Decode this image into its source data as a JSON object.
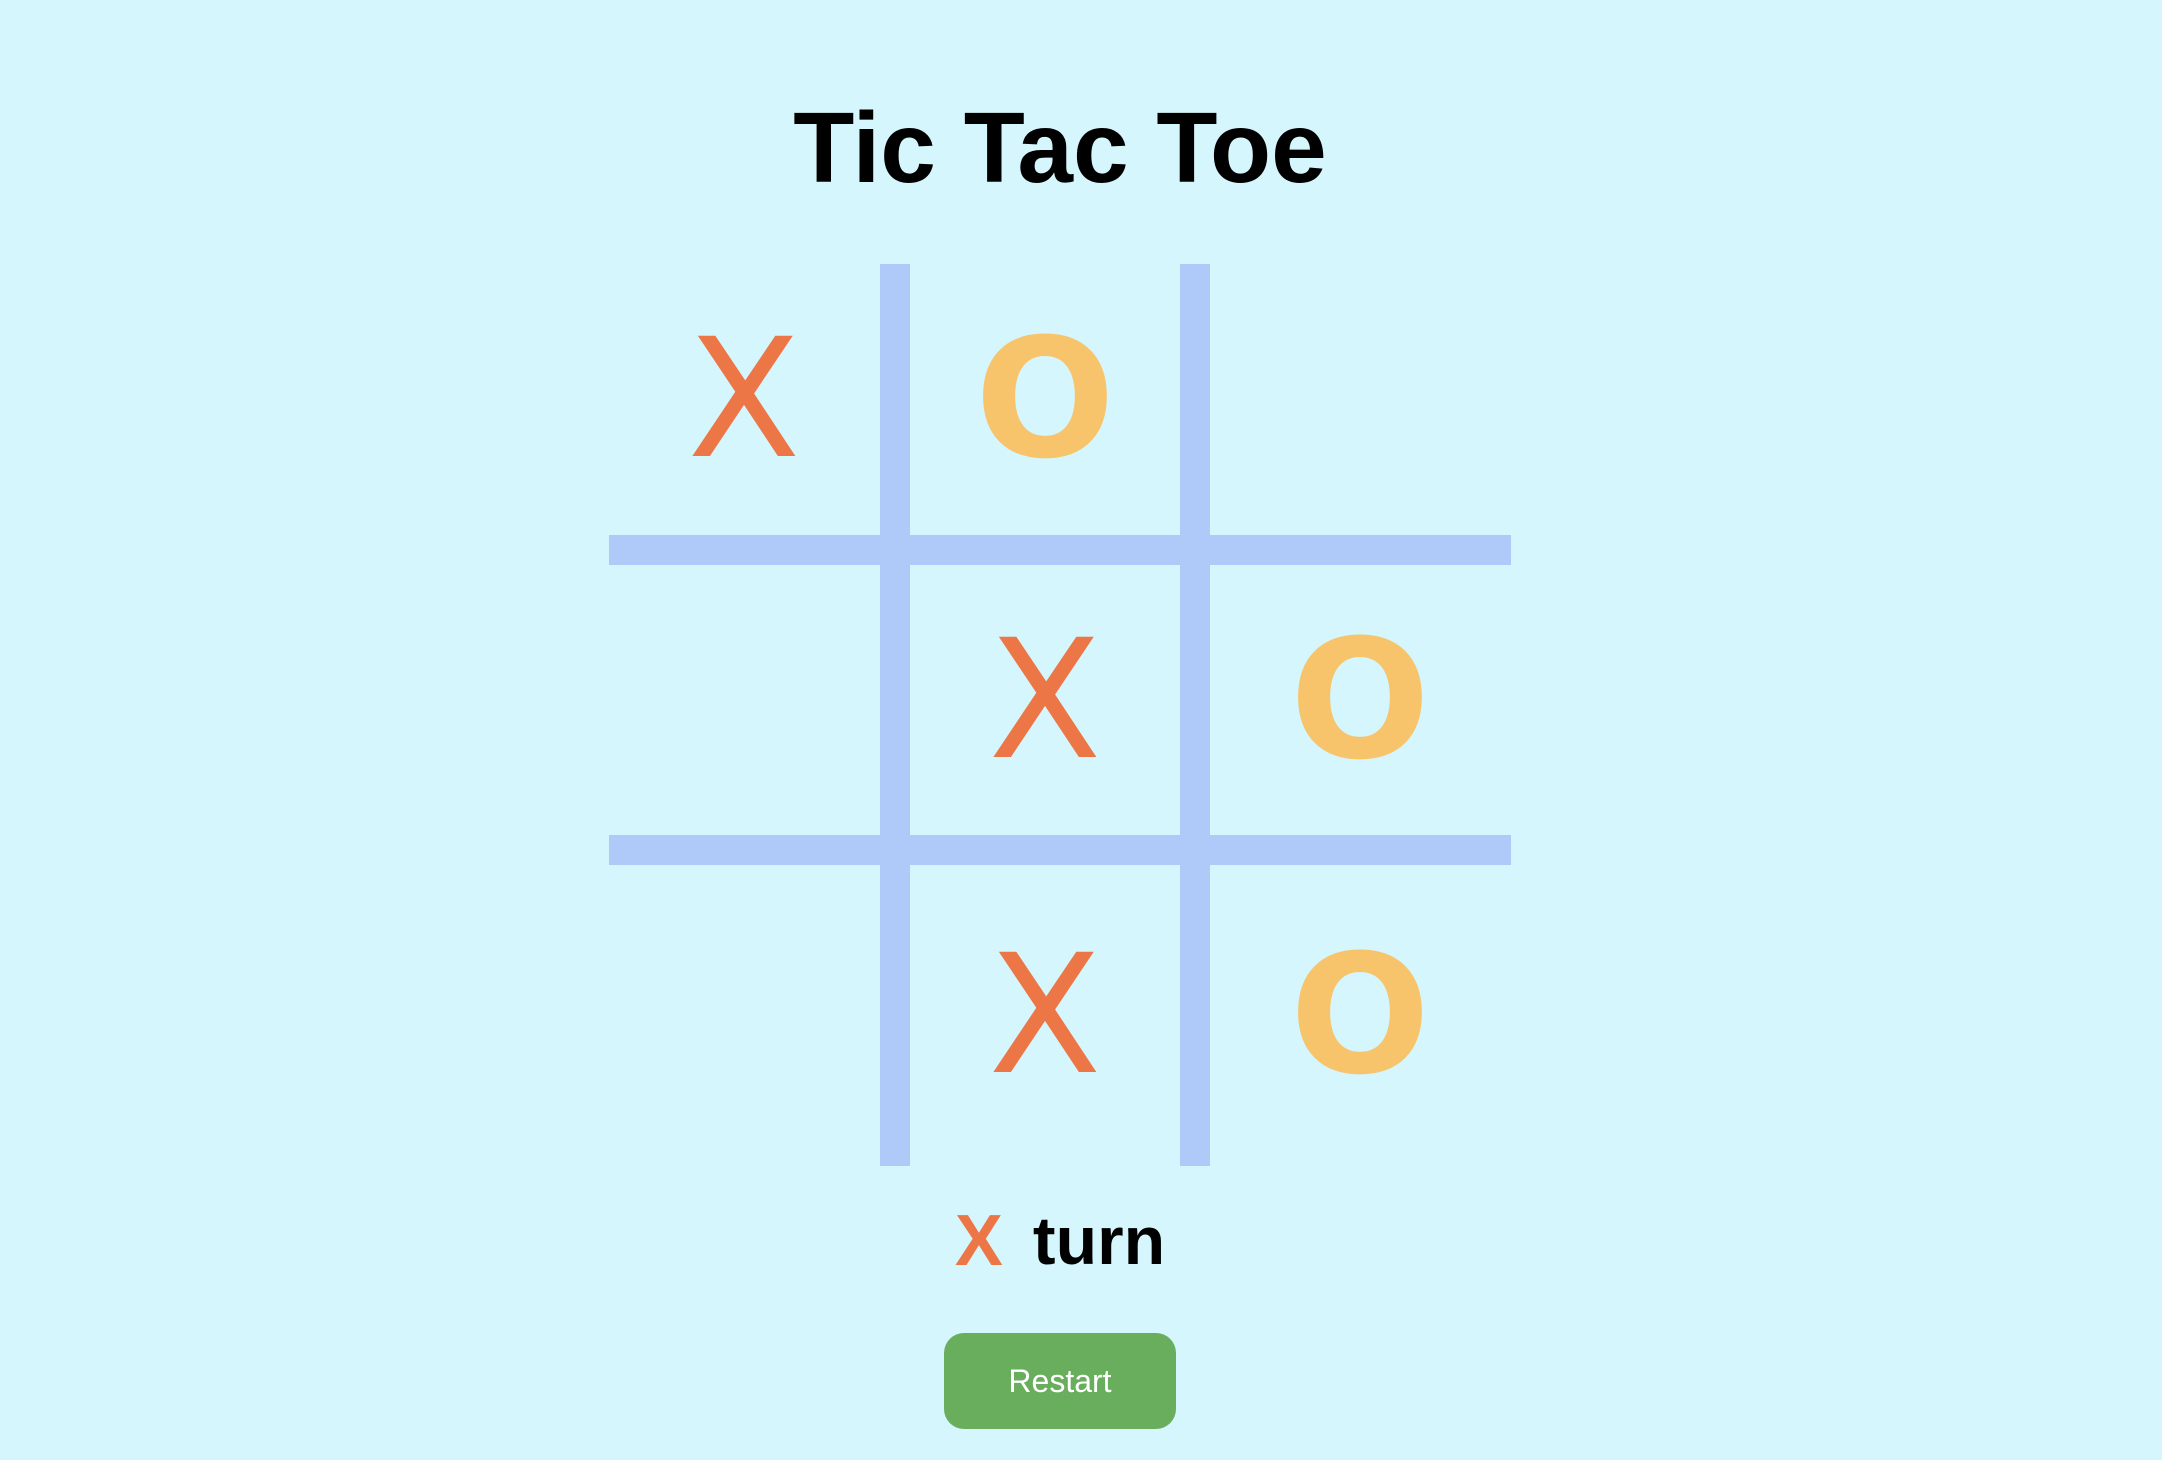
{
  "title": "Tic Tac Toe",
  "board": {
    "cells": [
      "X",
      "O",
      "",
      "",
      "X",
      "O",
      "",
      "X",
      "O"
    ]
  },
  "status": {
    "current_player": "X",
    "text": "turn"
  },
  "restart_label": "Restart",
  "colors": {
    "background": "#d4f6fc",
    "grid_line": "#afcaf9",
    "x_mark": "#ed7647",
    "o_mark": "#f7c46c",
    "restart_button": "#69ae5d"
  }
}
